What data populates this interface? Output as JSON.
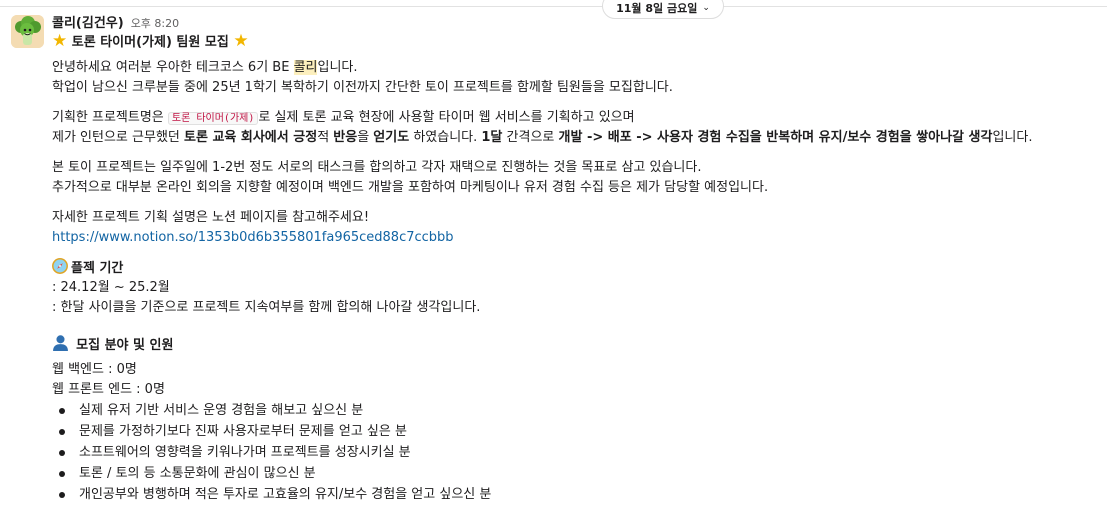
{
  "date_divider": {
    "label": "11월 8일 금요일"
  },
  "message": {
    "sender": "콜리(김건우)",
    "time": "오후 8:20",
    "title": "토론 타이머(가제) 팀원 모집",
    "intro": {
      "l1_a": "안녕하세요 여러분 우아한 테크코스 6기 BE ",
      "l1_hl": "콜리",
      "l1_b": "입니다.",
      "l2": "학업이 남으신 크루분들 중에 25년 1학기 복학하기 이전까지 간단한 토이 프로젝트를 함께할 팀원들을 모집합니다."
    },
    "plan": {
      "l1_a": "기획한 프로젝트명은 ",
      "l1_code": "토론 타이머(가제)",
      "l1_b": "로 실제 토론 교육 현장에 사용할 타이머 웹 서비스를 기획하고 있으며",
      "l2_a": "제가 인턴으로 근무했던 ",
      "l2_b1": "토론 교육 회사에서 긍정",
      "l2_c": "적 ",
      "l2_b2": "반응",
      "l2_d": "을 ",
      "l2_b3": "얻기도",
      "l2_e": " 하였습니다. ",
      "l2_b4": "1달",
      "l2_f": " 간격으로 ",
      "l2_b5": "개발 -> 배포 -> 사용자 경험 수집을 반복하며 유지/보수 경험을 쌓아나갈 생각",
      "l2_g": "입니다."
    },
    "goal": {
      "l1": "본 토이 프로젝트는 일주일에 1-2번 정도 서로의 태스크를 합의하고 각자 재택으로 진행하는 것을 목표로 삼고 있습니다.",
      "l2": "추가적으로 대부분 온라인 회의을 지향할 예정이며 백엔드 개발을 포함하여 마케팅이나 유저 경험 수집 등은 제가 담당할 예정입니다."
    },
    "detail": {
      "l1": "자세한 프로젝트 기획 설명은 노션 페이지를 참고해주세요!",
      "link": "https://www.notion.so/1353b0d6b355801fa965ced88c7ccbbb"
    },
    "period": {
      "heading": "플젝 기간",
      "l1": ": 24.12월 ~ 25.2월",
      "l2": ": 한달 사이클을 기준으로 프로젝트 지속여부를 함께 합의해 나아갈 생각입니다."
    },
    "recruit": {
      "heading": "모집 분야 및 인원",
      "l1": "웹 백엔드 : 0명",
      "l2": "웹 프론트 엔드 : 0명",
      "bullets": [
        "실제 유저 기반 서비스 운영 경험을 해보고 싶으신 분",
        "문제를 가정하기보다 진짜 사용자로부터 문제를 얻고 싶은 분",
        "소프트웨어의 영향력을 키워나가며 프로젝트를 성장시키실 분",
        "토론 / 토의 등 소통문화에 관심이 많으신 분",
        "개인공부와 병행하며 적은 투자로 고효율의 유지/보수 경험을 얻고 싶으신 분"
      ]
    }
  }
}
